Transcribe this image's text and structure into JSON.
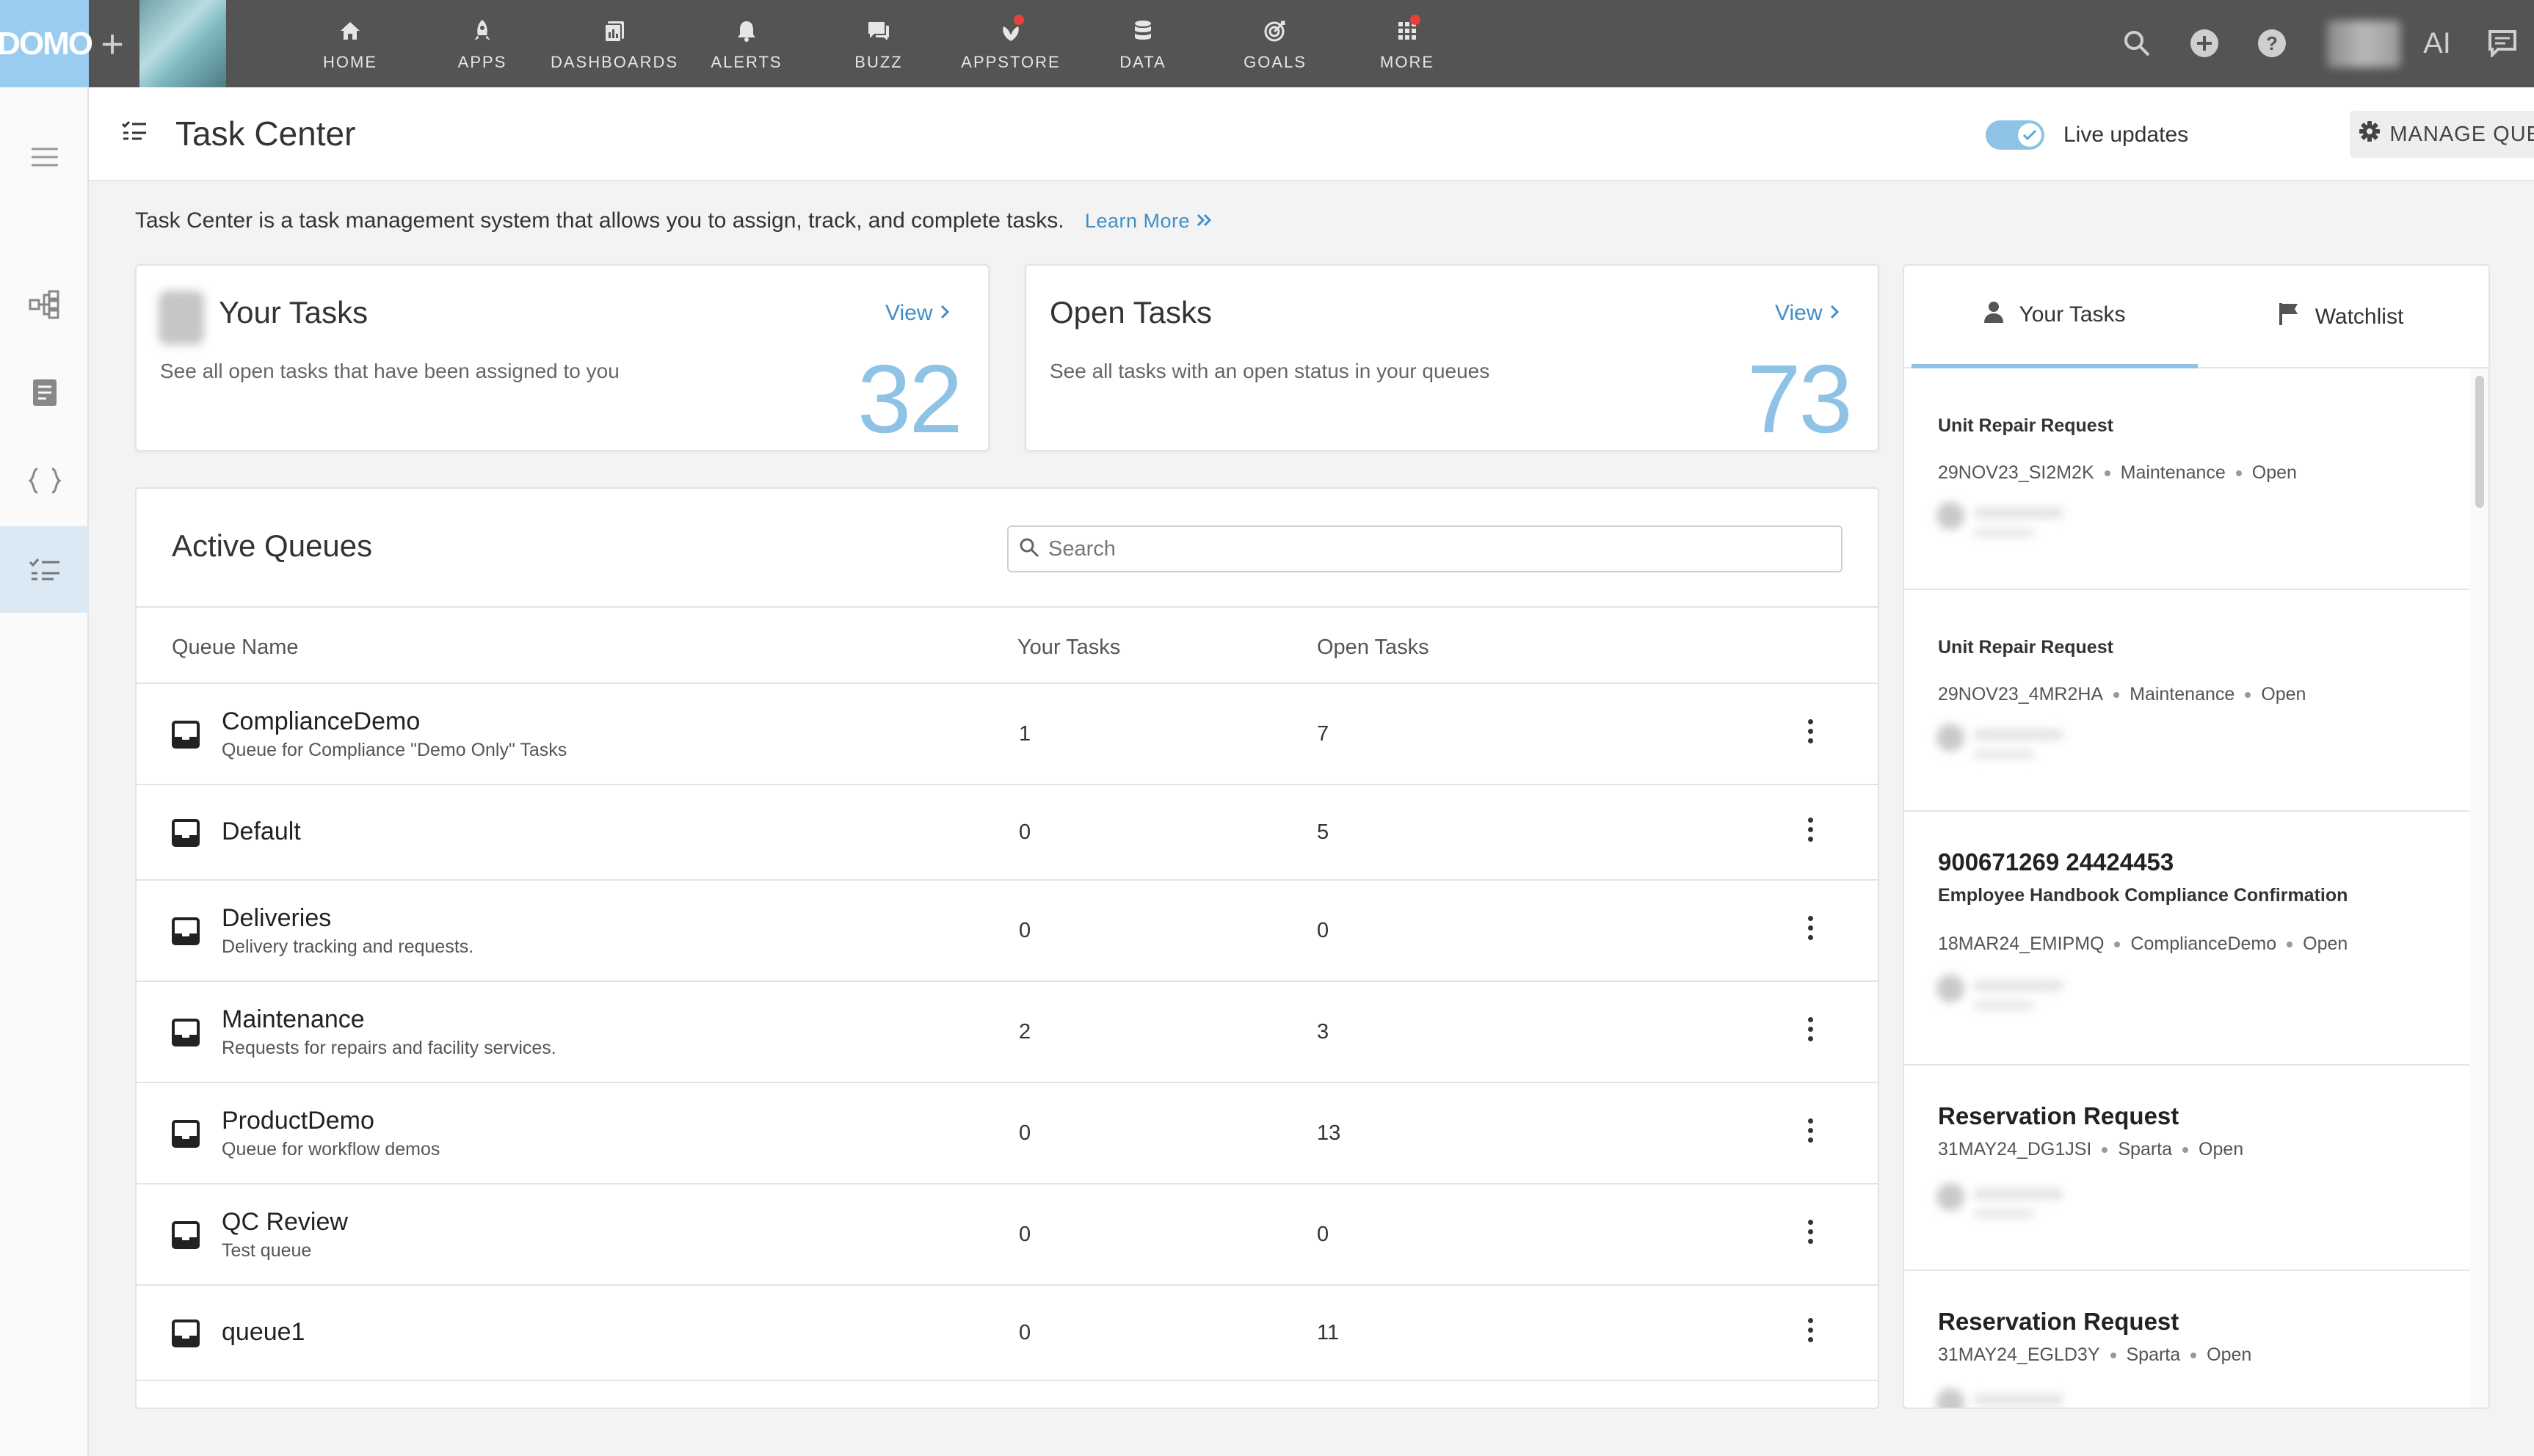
{
  "app": {
    "logo_text": "DOMO",
    "plus_label": "+"
  },
  "nav": {
    "items": [
      {
        "label": "HOME",
        "icon": "home-icon"
      },
      {
        "label": "APPS",
        "icon": "rocket-icon"
      },
      {
        "label": "DASHBOARDS",
        "icon": "dashboards-icon"
      },
      {
        "label": "ALERTS",
        "icon": "bell-icon"
      },
      {
        "label": "BUZZ",
        "icon": "chat-icon"
      },
      {
        "label": "APPSTORE",
        "icon": "appstore-icon",
        "badge": true
      },
      {
        "label": "DATA",
        "icon": "database-icon"
      },
      {
        "label": "GOALS",
        "icon": "target-icon"
      },
      {
        "label": "MORE",
        "icon": "grid-icon",
        "badge": true
      }
    ],
    "ai_label": "AI"
  },
  "header": {
    "title": "Task Center",
    "live_label": "Live updates",
    "live_on": true,
    "manage_label": "MANAGE QUEUES"
  },
  "intro": {
    "text": "Task Center is a task management system that allows you to assign, track, and complete tasks.",
    "learn_more": "Learn More"
  },
  "cards": {
    "your": {
      "title": "Your Tasks",
      "desc": "See all open tasks that have been assigned to you",
      "view": "View",
      "count": "32"
    },
    "open": {
      "title": "Open Tasks",
      "desc": "See all tasks with an open status in your queues",
      "view": "View",
      "count": "73"
    }
  },
  "queues": {
    "title": "Active Queues",
    "search_placeholder": "Search",
    "columns": {
      "name": "Queue Name",
      "your": "Your Tasks",
      "open": "Open Tasks"
    },
    "rows": [
      {
        "name": "ComplianceDemo",
        "desc": "Queue for Compliance \"Demo Only\" Tasks",
        "your": "1",
        "open": "7"
      },
      {
        "name": "Default",
        "desc": "",
        "your": "0",
        "open": "5"
      },
      {
        "name": "Deliveries",
        "desc": "Delivery tracking and requests.",
        "your": "0",
        "open": "0"
      },
      {
        "name": "Maintenance",
        "desc": "Requests for repairs and facility services.",
        "your": "2",
        "open": "3"
      },
      {
        "name": "ProductDemo",
        "desc": "Queue for workflow demos",
        "your": "0",
        "open": "13"
      },
      {
        "name": "QC Review",
        "desc": "Test queue",
        "your": "0",
        "open": "0"
      },
      {
        "name": "queue1",
        "desc": "",
        "your": "0",
        "open": "11"
      }
    ]
  },
  "panel": {
    "tabs": {
      "your": "Your Tasks",
      "watch": "Watchlist"
    },
    "tasks": [
      {
        "big": "",
        "title": "Unit Repair Request",
        "id": "29NOV23_SI2M2K",
        "queue": "Maintenance",
        "status": "Open"
      },
      {
        "big": "",
        "title": "Unit Repair Request",
        "id": "29NOV23_4MR2HA",
        "queue": "Maintenance",
        "status": "Open"
      },
      {
        "big": "900671269 24424453",
        "title": "Employee Handbook Compliance Confirmation",
        "id": "18MAR24_EMIPMQ",
        "queue": "ComplianceDemo",
        "status": "Open"
      },
      {
        "big": "Reservation Request",
        "title": "",
        "id": "31MAY24_DG1JSI",
        "queue": "Sparta",
        "status": "Open"
      },
      {
        "big": "Reservation Request",
        "title": "",
        "id": "31MAY24_EGLD3Y",
        "queue": "Sparta",
        "status": "Open"
      }
    ]
  }
}
